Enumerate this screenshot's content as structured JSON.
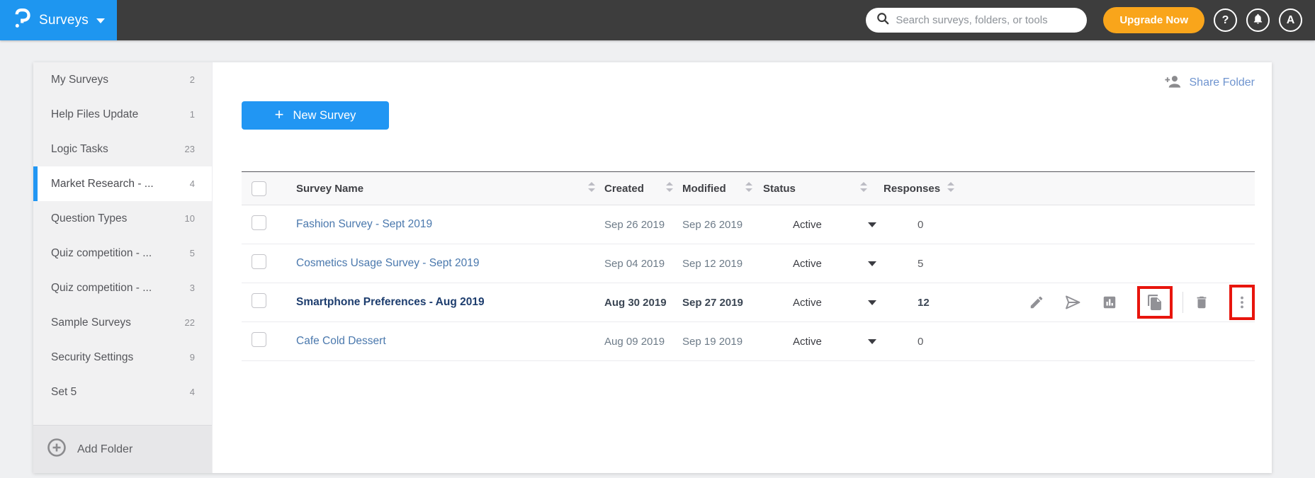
{
  "topbar": {
    "product": "Surveys",
    "search_placeholder": "Search surveys, folders, or tools",
    "upgrade_label": "Upgrade Now",
    "help_glyph": "?",
    "avatar_initial": "A"
  },
  "sidebar": {
    "items": [
      {
        "label": "My Surveys",
        "count": "2",
        "active": false
      },
      {
        "label": "Help Files Update",
        "count": "1",
        "active": false
      },
      {
        "label": "Logic Tasks",
        "count": "23",
        "active": false
      },
      {
        "label": "Market Research - ...",
        "count": "4",
        "active": true
      },
      {
        "label": "Question Types",
        "count": "10",
        "active": false
      },
      {
        "label": "Quiz competition - ...",
        "count": "5",
        "active": false
      },
      {
        "label": "Quiz competition - ...",
        "count": "3",
        "active": false
      },
      {
        "label": "Sample Surveys",
        "count": "22",
        "active": false
      },
      {
        "label": "Security Settings",
        "count": "9",
        "active": false
      },
      {
        "label": "Set 5",
        "count": "4",
        "active": false
      }
    ],
    "add_folder_label": "Add Folder"
  },
  "main": {
    "share_folder_label": "Share Folder",
    "new_survey_plus": "+",
    "new_survey_label": "New Survey",
    "table": {
      "columns": [
        "Survey Name",
        "Created",
        "Modified",
        "Status",
        "Responses"
      ],
      "action_names": [
        "edit",
        "send",
        "reports",
        "duplicate",
        "delete",
        "more"
      ],
      "rows": [
        {
          "name": "Fashion Survey - Sept 2019",
          "created": "Sep 26 2019",
          "modified": "Sep 26 2019",
          "status": "Active",
          "responses": "0",
          "bold": false,
          "show_actions": false,
          "highlighted": []
        },
        {
          "name": "Cosmetics Usage Survey - Sept 2019",
          "created": "Sep 04 2019",
          "modified": "Sep 12 2019",
          "status": "Active",
          "responses": "5",
          "bold": false,
          "show_actions": false,
          "highlighted": []
        },
        {
          "name": "Smartphone Preferences - Aug 2019",
          "created": "Aug 30 2019",
          "modified": "Sep 27 2019",
          "status": "Active",
          "responses": "12",
          "bold": true,
          "show_actions": true,
          "highlighted": [
            "duplicate",
            "more"
          ]
        },
        {
          "name": "Cafe Cold Dessert",
          "created": "Aug 09 2019",
          "modified": "Sep 19 2019",
          "status": "Active",
          "responses": "0",
          "bold": false,
          "show_actions": false,
          "highlighted": []
        }
      ]
    }
  },
  "colors": {
    "brand_blue": "#2196f3",
    "topbar_dark": "#3d3d3d",
    "upgrade_orange": "#f9a51b",
    "link_blue": "#4a78ad",
    "bold_name_navy": "#1d3d6e",
    "highlight_red": "#e8150d"
  }
}
